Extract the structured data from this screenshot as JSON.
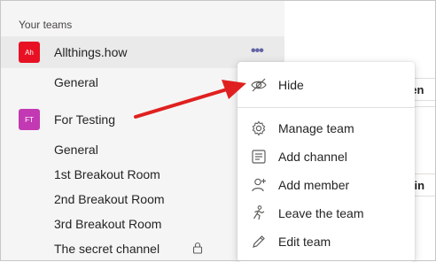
{
  "teams_panel": {
    "section_title": "Your teams",
    "teams": [
      {
        "avatar_text": "Ah",
        "avatar_color": "#e3008c",
        "name": "Allthings.how",
        "more_label": "•••",
        "channels": [
          "General"
        ]
      },
      {
        "avatar_text": "FT",
        "avatar_color": "#c239b3",
        "name": "For Testing",
        "channels": [
          "General",
          "1st Breakout Room",
          "2nd Breakout Room",
          "3rd Breakout Room",
          "The secret channel"
        ]
      }
    ]
  },
  "background": {
    "row1": "l en",
    "row2": "g in"
  },
  "context_menu": {
    "items": [
      {
        "label": "Hide",
        "icon": "hide-icon"
      },
      {
        "label": "Manage team",
        "icon": "gear-icon"
      },
      {
        "label": "Add channel",
        "icon": "channel-icon"
      },
      {
        "label": "Add member",
        "icon": "add-person-icon"
      },
      {
        "label": "Leave the team",
        "icon": "leave-icon"
      },
      {
        "label": "Edit team",
        "icon": "pencil-icon"
      }
    ]
  },
  "colors": {
    "accent": "#6264a7",
    "annotation_arrow": "#e02020",
    "avatar_allthings": "#e81123",
    "avatar_fortesting": "#c239b3"
  }
}
